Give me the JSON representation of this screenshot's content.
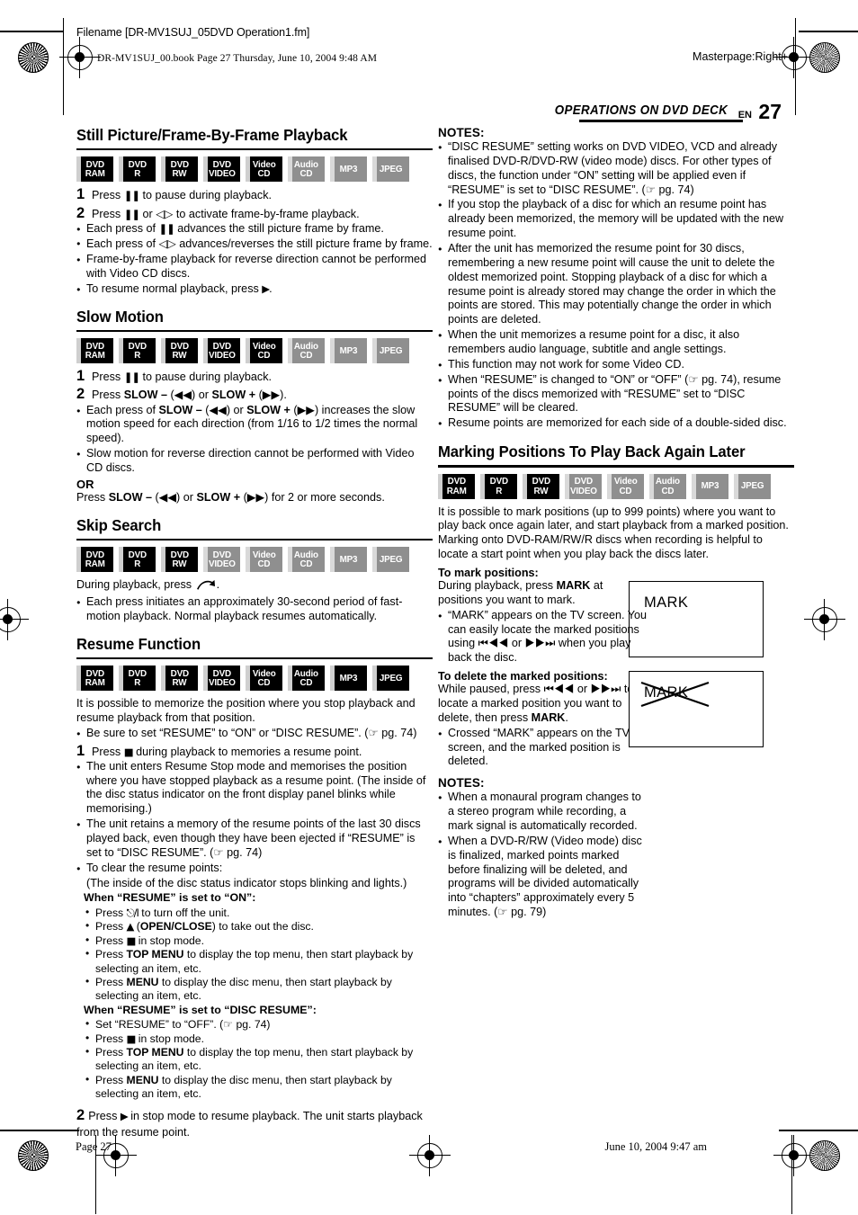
{
  "header": {
    "filename": "Filename [DR-MV1SUJ_05DVD Operation1.fm]",
    "book_line": "DR-MV1SUJ_00.book  Page 27  Thursday, June 10, 2004  9:48 AM",
    "masterpage": "Masterpage:Right+",
    "running_head": "OPERATIONS ON DVD DECK",
    "lang_code": "EN",
    "page_number": "27"
  },
  "footer": {
    "page_label": "Page 27",
    "date_label": "June 10, 2004 9:47 am"
  },
  "badge_labels": {
    "dvd": "DVD",
    "ram": "RAM",
    "r": "R",
    "rw": "RW",
    "video_upper": "VIDEO",
    "video": "Video",
    "cd": "CD",
    "audio": "Audio",
    "mp3": "MP3",
    "jpeg": "JPEG"
  },
  "sections": {
    "still_picture": {
      "title": "Still Picture/Frame-By-Frame Playback",
      "badges": [
        {
          "l1": "DVD",
          "l2": "RAM",
          "active": true
        },
        {
          "l1": "DVD",
          "l2": "R",
          "active": true
        },
        {
          "l1": "DVD",
          "l2": "RW",
          "active": true
        },
        {
          "l1": "DVD",
          "l2": "VIDEO",
          "active": true
        },
        {
          "l1": "Video",
          "l2": "CD",
          "active": true
        },
        {
          "l1": "Audio",
          "l2": "CD",
          "active": false
        },
        {
          "l1": "MP3",
          "l2": "",
          "active": false
        },
        {
          "l1": "JPEG",
          "l2": "",
          "active": false
        }
      ],
      "step1_num": "1",
      "step1": "Press ▐▌ to pause during playback.",
      "step1_a": "Press ",
      "step1_b": " to pause during playback.",
      "step2_num": "2",
      "step2_a": "Press ",
      "step2_b": " or ",
      "step2_c": " to activate frame-by-frame playback.",
      "b1_a": "Each press of ",
      "b1_b": " advances the still picture frame by frame.",
      "b2_a": "Each press of ",
      "b2_b": " advances/reverses the still picture frame by frame.",
      "b3": "Frame-by-frame playback for reverse direction cannot be performed with Video CD discs.",
      "b4_a": "To resume normal playback, press ",
      "b4_b": "."
    },
    "slow_motion": {
      "title": "Slow Motion",
      "badges": [
        {
          "l1": "DVD",
          "l2": "RAM",
          "active": true
        },
        {
          "l1": "DVD",
          "l2": "R",
          "active": true
        },
        {
          "l1": "DVD",
          "l2": "RW",
          "active": true
        },
        {
          "l1": "DVD",
          "l2": "VIDEO",
          "active": true
        },
        {
          "l1": "Video",
          "l2": "CD",
          "active": true
        },
        {
          "l1": "Audio",
          "l2": "CD",
          "active": false
        },
        {
          "l1": "MP3",
          "l2": "",
          "active": false
        },
        {
          "l1": "JPEG",
          "l2": "",
          "active": false
        }
      ],
      "step1_num": "1",
      "step1_a": "Press ",
      "step1_b": " to pause during playback.",
      "step2_num": "2",
      "step2_a": "Press ",
      "step2_slow_minus": "SLOW –",
      "step2_b": " (◀◀) or ",
      "step2_slow_plus": "SLOW +",
      "step2_c": " (▶▶).",
      "b1_a": "Each press of ",
      "b1_b": " (◀◀) or ",
      "b1_c": " (▶▶) increases the slow motion speed for each direction (from 1/16 to 1/2 times the normal speed).",
      "b2": "Slow motion for reverse direction cannot be performed with Video CD discs.",
      "or": "OR",
      "or_line_a": "Press ",
      "or_line_b": " (◀◀) or ",
      "or_line_c": " (▶▶) for 2 or more seconds."
    },
    "skip_search": {
      "title": "Skip Search",
      "badges": [
        {
          "l1": "DVD",
          "l2": "RAM",
          "active": true
        },
        {
          "l1": "DVD",
          "l2": "R",
          "active": true
        },
        {
          "l1": "DVD",
          "l2": "RW",
          "active": true
        },
        {
          "l1": "DVD",
          "l2": "VIDEO",
          "active": false
        },
        {
          "l1": "Video",
          "l2": "CD",
          "active": false
        },
        {
          "l1": "Audio",
          "l2": "CD",
          "active": false
        },
        {
          "l1": "MP3",
          "l2": "",
          "active": false
        },
        {
          "l1": "JPEG",
          "l2": "",
          "active": false
        }
      ],
      "line_a": "During playback, press ",
      "line_b": ".",
      "b1": "Each press initiates an approximately 30-second period of fast-motion playback. Normal playback resumes automatically."
    },
    "resume_function": {
      "title": "Resume Function",
      "badges": [
        {
          "l1": "DVD",
          "l2": "RAM",
          "active": true
        },
        {
          "l1": "DVD",
          "l2": "R",
          "active": true
        },
        {
          "l1": "DVD",
          "l2": "RW",
          "active": true
        },
        {
          "l1": "DVD",
          "l2": "VIDEO",
          "active": true
        },
        {
          "l1": "Video",
          "l2": "CD",
          "active": true
        },
        {
          "l1": "Audio",
          "l2": "CD",
          "active": true
        },
        {
          "l1": "MP3",
          "l2": "",
          "active": true
        },
        {
          "l1": "JPEG",
          "l2": "",
          "active": true
        }
      ],
      "intro": "It is possible to memorize the position where you stop playback and resume playback from that position.",
      "b0": "Be sure to set “RESUME” to “ON” or “DISC RESUME”. (☞ pg. 74)",
      "step1_num": "1",
      "step1_a": "Press ",
      "step1_b": " during playback to memories a resume point.",
      "b1": "The unit enters Resume Stop mode and memorises the position where you have stopped playback as a resume point. (The inside of the disc status indicator on the front display panel blinks while memorising.)",
      "b2": "The unit retains a memory of the resume points of the last 30 discs played back, even though they have been ejected if “RESUME” is set to “DISC RESUME”. (☞ pg. 74)",
      "b3": "To clear the resume points:",
      "b3_sub": "(The inside of the disc status indicator stops blinking and lights.)",
      "on_head": "When “RESUME” is set to “ON”:",
      "on_1_a": "Press ",
      "on_1_b": " to turn off the unit.",
      "on_2_a": "Press ",
      "on_2_b": " (",
      "on_2_open": "OPEN/CLOSE",
      "on_2_c": ") to take out the disc.",
      "on_3_a": "Press ",
      "on_3_b": " in stop mode.",
      "on_4_a": "Press ",
      "on_4_key": "TOP MENU",
      "on_4_b": " to display the top menu, then start playback by selecting an item, etc.",
      "on_5_a": "Press ",
      "on_5_key": "MENU",
      "on_5_b": " to display the disc menu, then start playback by selecting an item, etc.",
      "disc_head": "When “RESUME” is set to “DISC RESUME”:",
      "d_1": "Set “RESUME” to “OFF”. (☞ pg. 74)",
      "d_2_a": "Press ",
      "d_2_b": " in stop mode.",
      "d_3_a": "Press ",
      "d_3_key": "TOP MENU",
      "d_3_b": " to display the top menu, then start playback by selecting an item, etc.",
      "d_4_a": "Press ",
      "d_4_key": "MENU",
      "d_4_b": " to display the disc menu, then start playback by selecting an item, etc.",
      "step2_num": "2",
      "step2_a": "Press ",
      "step2_b": " in stop mode to resume playback. The unit starts playback from the resume point."
    },
    "notes_resume": {
      "title": "NOTES:",
      "items": [
        "“DISC RESUME” setting works on DVD VIDEO, VCD and already finalised DVD-R/DVD-RW (video mode) discs. For other types of discs, the function under “ON” setting will be applied even if “RESUME” is set to “DISC RESUME”. (☞ pg. 74)",
        "If you stop the playback of a disc for which an resume point has already been memorized, the memory will be updated with the new resume point.",
        "After the unit has memorized the resume point for 30 discs, remembering a new resume point will cause the unit to delete the oldest memorized point. Stopping playback of a disc for which a resume point is already stored may change the order in which the points are stored. This may potentially change the order in which points are deleted.",
        "When the unit memorizes a resume point for a disc, it also remembers audio language, subtitle and angle settings.",
        "This function may not work for some Video CD.",
        "When “RESUME” is changed to “ON” or “OFF” (☞ pg. 74), resume points of the discs memorized with “RESUME” set to “DISC RESUME” will be cleared.",
        "Resume points are memorized for each side of a double-sided disc."
      ]
    },
    "marking": {
      "title": "Marking Positions To Play Back Again Later",
      "badges": [
        {
          "l1": "DVD",
          "l2": "RAM",
          "active": true
        },
        {
          "l1": "DVD",
          "l2": "R",
          "active": true
        },
        {
          "l1": "DVD",
          "l2": "RW",
          "active": true
        },
        {
          "l1": "DVD",
          "l2": "VIDEO",
          "active": false
        },
        {
          "l1": "Video",
          "l2": "CD",
          "active": false
        },
        {
          "l1": "Audio",
          "l2": "CD",
          "active": false
        },
        {
          "l1": "MP3",
          "l2": "",
          "active": false
        },
        {
          "l1": "JPEG",
          "l2": "",
          "active": false
        }
      ],
      "intro": "It is possible to mark positions (up to 999 points) where you want to play back once again later, and start playback from a marked position. Marking onto DVD-RAM/RW/R discs when recording is helpful to locate a start point when you play back the discs later.",
      "mark_head": "To mark positions:",
      "mark_line_a": "During playback, press ",
      "mark_key": "MARK",
      "mark_line_b": " at positions you want to mark.",
      "mark_b1": "“MARK” appears on the TV screen. You can easily locate the marked positions using ⏮◀◀ or ▶▶⏭ when you play back the disc.",
      "del_head": "To delete the marked positions:",
      "del_line": "While paused, press ⏮◀◀ or ▶▶⏭ to locate a marked position you want to delete, then press ",
      "del_key": "MARK",
      "del_line_end": ".",
      "del_b1": "Crossed “MARK” appears on the TV screen, and the marked position is deleted.",
      "tv_mark": "MARK",
      "tv_mark_crossed": "MARK"
    },
    "notes_marking": {
      "title": "NOTES:",
      "items": [
        "When a monaural program changes to a stereo program while recording, a mark signal is automatically recorded.",
        "When a DVD-R/RW (Video mode) disc is finalized, marked points marked before finalizing will be deleted, and programs will be divided automatically into “chapters” approximately every 5 minutes. (☞ pg. 79)"
      ]
    }
  }
}
